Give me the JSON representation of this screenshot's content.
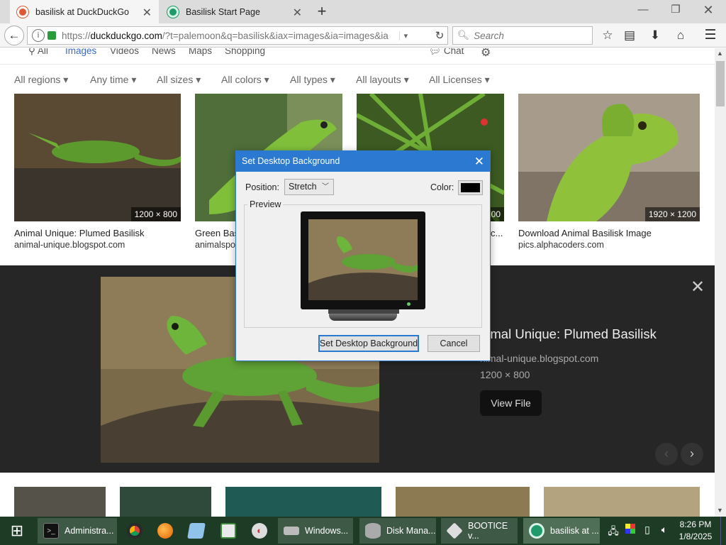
{
  "browser": {
    "tabs": [
      {
        "label": "basilisk at DuckDuckGo",
        "active": true,
        "icon": "duckduckgo-icon"
      },
      {
        "label": "Basilisk Start Page",
        "active": false,
        "icon": "basilisk-icon"
      }
    ],
    "url": {
      "host": "duckduckgo.com",
      "prefix": "https://",
      "path": "/?t=palemoon&q=basilisk&iax=images&ia=images&ia"
    },
    "search_placeholder": "Search"
  },
  "ddg": {
    "nav": [
      "All",
      "Images",
      "Videos",
      "News",
      "Maps",
      "Shopping"
    ],
    "active_nav": "Images",
    "chat_label": "Chat",
    "filters": [
      "All regions",
      "Any time",
      "All sizes",
      "All colors",
      "All types",
      "All layouts",
      "All Licenses"
    ],
    "results": [
      {
        "title": "Animal Unique: Plumed Basilisk",
        "source": "animal-unique.blogspot.com",
        "dims": "1200 × 800"
      },
      {
        "title": "Green Basilisk",
        "source": "animalspot",
        "dims": ""
      },
      {
        "title": "",
        "source": "",
        "dims": "00",
        "caption_tail": "c..."
      },
      {
        "title": "Download Animal Basilisk Image",
        "source": "pics.alphacoders.com",
        "dims": "1920 × 1200"
      }
    ],
    "detail": {
      "title": "nimal Unique: Plumed Basilisk",
      "source": "nimal-unique.blogspot.com",
      "dims": "1200 × 800",
      "view_file": "View File"
    }
  },
  "dialog": {
    "title": "Set Desktop Background",
    "position_label": "Position:",
    "position_value": "Stretch",
    "color_label": "Color:",
    "color_value": "#000000",
    "preview_label": "Preview",
    "ok_label": "Set Desktop Background",
    "cancel_label": "Cancel"
  },
  "taskbar": {
    "tasks": [
      {
        "label": "Administra...",
        "icon": "cmd-icon"
      },
      {
        "label": "",
        "icon": "chrome-icon"
      },
      {
        "label": "",
        "icon": "firefox-icon"
      },
      {
        "label": "",
        "icon": "notepad-icon"
      },
      {
        "label": "",
        "icon": "spreadsheet-icon"
      },
      {
        "label": "",
        "icon": "paint-icon"
      },
      {
        "label": "Windows...",
        "icon": "drive-icon"
      },
      {
        "label": "Disk Mana...",
        "icon": "disk-icon"
      },
      {
        "label": "BOOTICE v...",
        "icon": "bootice-icon"
      },
      {
        "label": "basilisk at ...",
        "icon": "basilisk-icon"
      }
    ],
    "time": "8:26 PM",
    "date": "1/8/2025"
  },
  "colors": {
    "accent": "#2b79d0",
    "ddg_active": "#3969c6",
    "taskbar": "#1e3b26"
  }
}
